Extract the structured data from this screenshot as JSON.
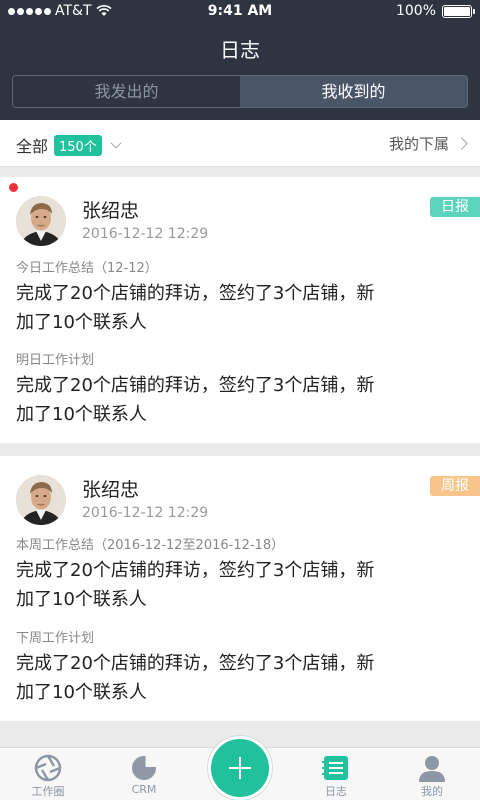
{
  "status_bar": {
    "carrier": "AT&T",
    "time": "9:41 AM",
    "battery": "100%",
    "battery_level": 1.0
  },
  "header": {
    "title": "日志"
  },
  "segment": {
    "sent": "我发出的",
    "received": "我收到的"
  },
  "filter": {
    "all_label": "全部",
    "count": "150个",
    "subordinates": "我的下属"
  },
  "reports": [
    {
      "name": "张绍忠",
      "time": "2016-12-12 12:29",
      "type": "日报",
      "section1_label": "今日工作总结（12-12）",
      "section1_line1": "完成了20个店铺的拜访，签约了3个店铺，新",
      "section1_line2": "加了10个联系人",
      "section2_label": "明日工作计划",
      "section2_line1": "完成了20个店铺的拜访，签约了3个店铺，新",
      "section2_line2": "加了10个联系人"
    },
    {
      "name": "张绍忠",
      "time": "2016-12-12 12:29",
      "type": "周报",
      "section1_label": "本周工作总结（2016-12-12至2016-12-18）",
      "section1_line1": "完成了20个店铺的拜访，签约了3个店铺，新",
      "section1_line2": "加了10个联系人",
      "section2_label": "下周工作计划",
      "section2_line1": "完成了20个店铺的拜访，签约了3个店铺，新",
      "section2_line2": "加了10个联系人"
    }
  ],
  "tabs": [
    {
      "label": "工作圈",
      "icon": "aperture-icon"
    },
    {
      "label": "CRM",
      "icon": "pie-chart-icon"
    },
    {
      "label": "",
      "icon": "add-icon"
    },
    {
      "label": "日志",
      "icon": "journal-icon"
    },
    {
      "label": "我的",
      "icon": "user-icon"
    }
  ],
  "colors": {
    "accent": "#22c19d",
    "header_bg": "#2f3540",
    "daily_badge": "#5cd4bd",
    "weekly_badge": "#f7c58c",
    "unread": "#f0303a"
  }
}
